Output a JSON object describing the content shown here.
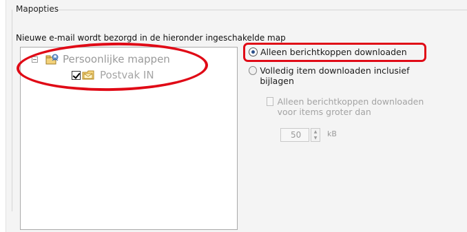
{
  "group": {
    "title": "Mapopties",
    "description": "Nieuwe e-mail wordt bezorgd in de hieronder ingeschakelde map"
  },
  "tree": {
    "root": {
      "label": "Persoonlijke mappen",
      "icon": "personal-folders-icon",
      "expanded": true
    },
    "child": {
      "label": "Postvak IN",
      "icon": "inbox-folder-icon",
      "checked": true
    }
  },
  "options": {
    "headers_only": {
      "label": "Alleen berichtkoppen downloaden",
      "selected": true
    },
    "full_item": {
      "label": "Volledig item downloaden inclusief bijlagen",
      "selected": false
    },
    "large_items": {
      "label": "Alleen berichtkoppen downloaden voor items groter dan",
      "checked": false,
      "enabled": false
    },
    "size": {
      "value": "50",
      "unit": "kB"
    }
  },
  "colors": {
    "highlight": "#e00a16",
    "accent": "#2a4f8a"
  }
}
